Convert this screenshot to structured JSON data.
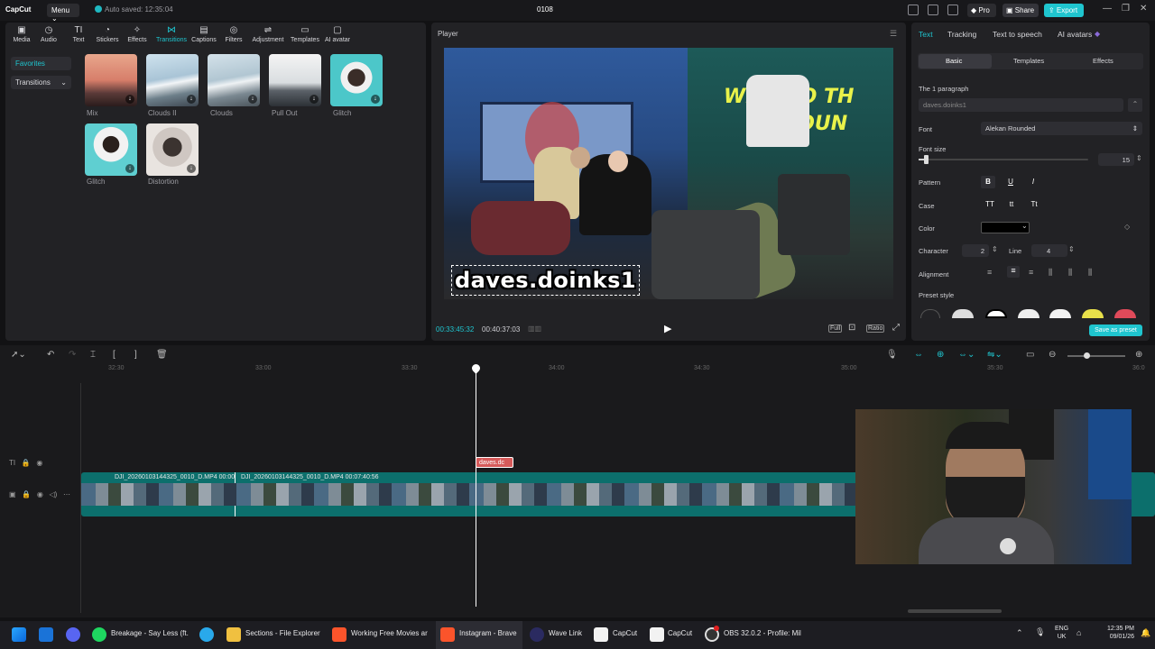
{
  "titlebar": {
    "logo": "CapCut",
    "menu": "Menu ⌄",
    "autosave": "Auto saved: 12:35:04",
    "project": "0108",
    "pro": "◆ Pro",
    "share": "▣ Share",
    "export": "⇪ Export"
  },
  "toolbar": {
    "items": [
      {
        "label": "Media",
        "icon": "media-icon"
      },
      {
        "label": "Audio",
        "icon": "audio-icon"
      },
      {
        "label": "Text",
        "icon": "text-icon"
      },
      {
        "label": "Stickers",
        "icon": "stickers-icon"
      },
      {
        "label": "Effects",
        "icon": "effects-icon"
      },
      {
        "label": "Transitions",
        "icon": "transitions-icon"
      },
      {
        "label": "Captions",
        "icon": "captions-icon"
      },
      {
        "label": "Filters",
        "icon": "filters-icon"
      },
      {
        "label": "Adjustment",
        "icon": "adjustment-icon"
      },
      {
        "label": "Templates",
        "icon": "templates-icon"
      },
      {
        "label": "AI avatar",
        "icon": "ai-avatar-icon"
      }
    ]
  },
  "sidebar": {
    "favorites": "Favorites",
    "transitions": "Transitions"
  },
  "transitions": [
    "Mix",
    "Clouds II",
    "Clouds",
    "Pull Out",
    "Glitch",
    "Glitch",
    "Distortion"
  ],
  "player": {
    "label": "Player",
    "caption": "daves.doinks1",
    "current": "00:33:45:32",
    "total": "00:40:37:03",
    "full": "Full",
    "ratio": "Ratio"
  },
  "props": {
    "tabs": [
      "Text",
      "Tracking",
      "Text to speech",
      "AI avatars"
    ],
    "subtabs": [
      "Basic",
      "Templates",
      "Effects"
    ],
    "paragraph_label": "The 1 paragraph",
    "paragraph_value": "daves.doinks1",
    "font_label": "Font",
    "font_value": "Alekan Rounded",
    "font_size_label": "Font size",
    "font_size_value": "15",
    "pattern_label": "Pattern",
    "case_label": "Case",
    "case_opts": [
      "TT",
      "tt",
      "Tt"
    ],
    "color_label": "Color",
    "character_label": "Character",
    "character_value": "2",
    "line_label": "Line",
    "line_value": "4",
    "alignment_label": "Alignment",
    "preset_label": "Preset style",
    "save_preset": "Save as preset",
    "color_value": "#000000"
  },
  "timeline": {
    "ticks": [
      "32:30",
      "33:00",
      "33:30",
      "34:00",
      "34:30",
      "35:00",
      "35:30",
      "36:0"
    ],
    "text_clip": "daves.dc",
    "clip1": "DJI_20260103144325_0010_D.MP4  00:00",
    "clip2": "DJI_20260103144325_0010_D.MP4  00:07:40:56"
  },
  "taskbar": {
    "items": [
      "Breakage - Say Less (ft.",
      "Sections - File Explorer",
      "Working Free Movies ar",
      "Instagram - Brave",
      "Wave Link",
      "CapCut",
      "CapCut",
      "OBS 32.0.2 - Profile: Mil"
    ],
    "lang1": "ENG",
    "lang2": "UK",
    "time": "12:35 PM",
    "date": "09/01/26"
  }
}
